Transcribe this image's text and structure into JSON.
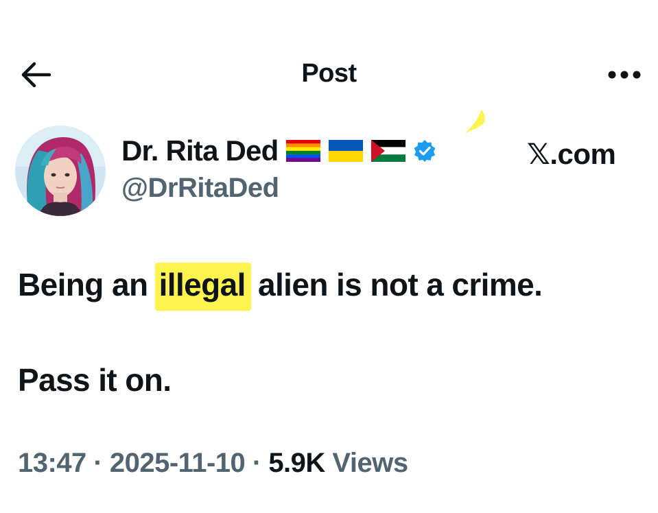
{
  "header": {
    "title": "Post",
    "back_icon": "arrow-left-icon",
    "more_icon": "more-horizontal-icon"
  },
  "author": {
    "display_name": "Dr. Rita Ded",
    "handle": "@DrRitaDed",
    "badges": [
      "rainbow-flag-icon",
      "ukraine-flag-icon",
      "palestine-flag-icon",
      "verified-badge-icon"
    ],
    "verified_color": "#1d9bf0"
  },
  "source_label": "𝕏.com",
  "post": {
    "line1_before": "Being an ",
    "line1_highlight": "illegal",
    "line1_after": " alien is not a crime.",
    "line2": "Pass it on.",
    "highlight_color": "#fff44f"
  },
  "meta": {
    "time": "13:47",
    "separator": " · ",
    "date": "2025-11-10",
    "views_count": "5.9K",
    "views_label": " Views"
  }
}
